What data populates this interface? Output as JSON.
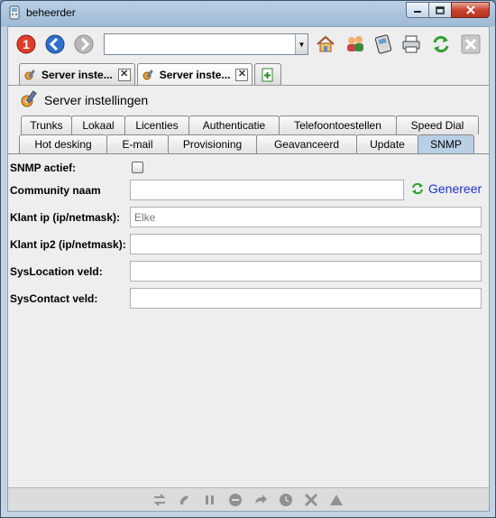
{
  "window": {
    "title": "beheerder"
  },
  "toolbar": {
    "url_value": "",
    "icons": [
      "alert-icon",
      "back-icon",
      "forward-icon",
      "home-icon",
      "users-icon",
      "phone-device-icon",
      "printer-icon",
      "refresh-icon",
      "close-icon"
    ]
  },
  "doc_tabs": [
    {
      "label": "Server inste...",
      "active": false
    },
    {
      "label": "Server inste...",
      "active": true
    }
  ],
  "page": {
    "title": "Server instellingen"
  },
  "tabs_row1": [
    "Trunks",
    "Lokaal",
    "Licenties",
    "Authenticatie",
    "Telefoontoestellen",
    "Speed Dial"
  ],
  "tabs_row2": [
    "Hot desking",
    "E-mail",
    "Provisioning",
    "Geavanceerd",
    "Update",
    "SNMP"
  ],
  "selected_tab": "SNMP",
  "form": {
    "snmp_label": "SNMP actief:",
    "snmp_checked": false,
    "community_label": "Community naam",
    "community_value": "",
    "generate_label": "Genereer",
    "client_ip_label": "Klant ip (ip/netmask):",
    "client_ip_placeholder": "Elke",
    "client_ip2_label": "Klant ip2 (ip/netmask):",
    "client_ip2_value": "",
    "syslocation_label": "SysLocation veld:",
    "syslocation_value": "",
    "syscontact_label": "SysContact veld:",
    "syscontact_value": ""
  },
  "colors": {
    "selected_tab": "#b8cfe5",
    "link": "#2233cc"
  }
}
